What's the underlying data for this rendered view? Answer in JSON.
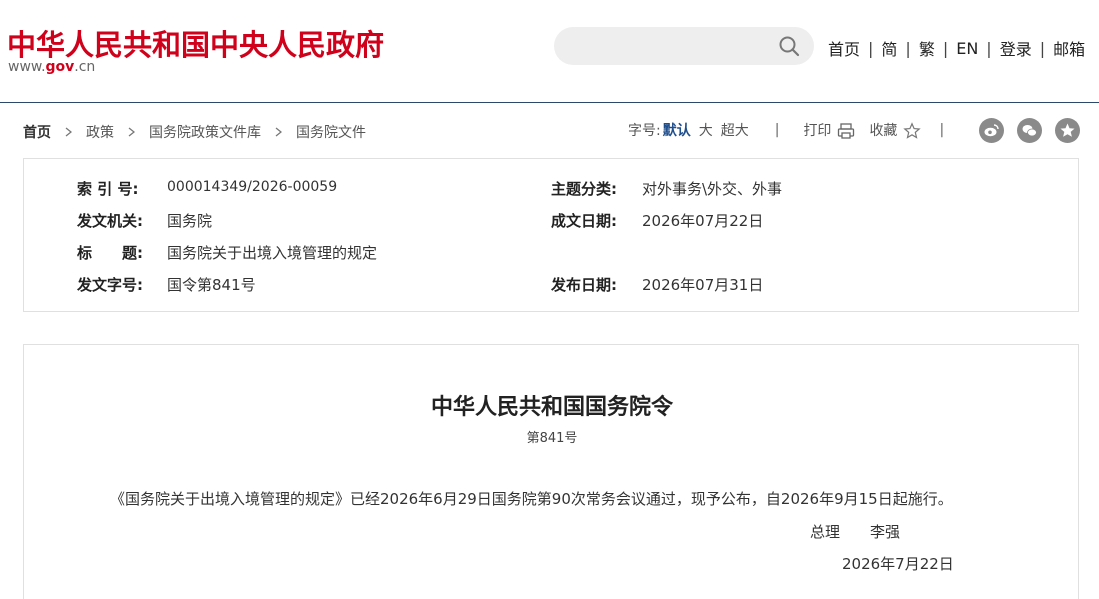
{
  "header": {
    "site_title": "中华人民共和国中央人民政府",
    "url_prefix": "www.",
    "url_gov": "gov",
    "url_suffix": ".cn",
    "search": {
      "value": "",
      "placeholder": ""
    },
    "links": [
      "首页",
      "简",
      "繁",
      "EN",
      "登录",
      "邮箱"
    ],
    "separator": "|"
  },
  "breadcrumb": {
    "items": [
      "首页",
      "政策",
      "国务院政策文件库",
      "国务院文件"
    ]
  },
  "tools": {
    "font_size_label": "字号:",
    "font_default": "默认",
    "font_large": "大",
    "font_xlarge": "超大",
    "print_label": "打印",
    "favorite_label": "收藏",
    "separator": "|"
  },
  "info": {
    "index_label": "索 引 号:",
    "index_value": "000014349/2026-00059",
    "topic_label": "主题分类:",
    "topic_value": "对外事务\\外交、外事",
    "issuer_label": "发文机关:",
    "issuer_value": "国务院",
    "written_label": "成文日期:",
    "written_value": "2026年07月22日",
    "title_label": "标　　题:",
    "title_value": "国务院关于出境入境管理的规定",
    "docno_label": "发文字号:",
    "docno_value": "国令第841号",
    "publish_label": "发布日期:",
    "publish_value": "2026年07月31日"
  },
  "document": {
    "title": "中华人民共和国国务院令",
    "number": "第841号",
    "body": "《国务院关于出境入境管理的规定》已经2026年6月29日国务院第90次常务会议通过，现予公布，自2026年9月15日起施行。",
    "signer_title": "总理",
    "signer_name": "李强",
    "date": "2026年7月22日"
  },
  "colors": {
    "brand_red": "#d0021b",
    "accent_blue": "#1f4e8c",
    "header_rule": "#2b4a6b"
  }
}
